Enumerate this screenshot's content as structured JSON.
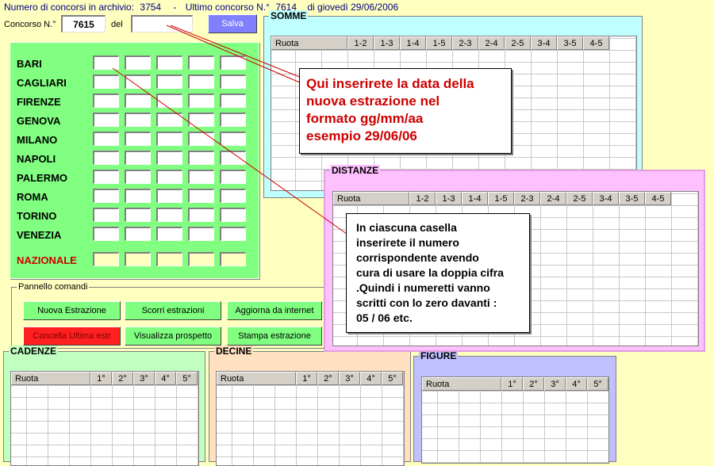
{
  "top": {
    "count_label": "Numero di concorsi in archivio:",
    "count_value": "3754",
    "sep": "-",
    "last_label": "Ultimo concorso N.°",
    "last_value": "7614",
    "date_label": "di giovedì 29/06/2006"
  },
  "form": {
    "concorso_label": "Concorso N.°",
    "concorso_value": "7615",
    "del_label": "del",
    "date_value": "",
    "save_label": "Salva"
  },
  "cities": [
    "BARI",
    "CAGLIARI",
    "FIRENZE",
    "GENOVA",
    "MILANO",
    "NAPOLI",
    "PALERMO",
    "ROMA",
    "TORINO",
    "VENEZIA"
  ],
  "nazionale": "NAZIONALE",
  "commands": {
    "title": "Pannello comandi",
    "nuova": "Nuova Estrazione",
    "scorri": "Scorri estrazioni",
    "aggiorna": "Aggiorna da internet",
    "cancella": "Cancella Ultima estr",
    "visualizza": "Visualizza prospetto",
    "stampa": "Stampa estrazione"
  },
  "somme": {
    "title": "SOMME",
    "headers": [
      "Ruota",
      "1-2",
      "1-3",
      "1-4",
      "1-5",
      "2-3",
      "2-4",
      "2-5",
      "3-4",
      "3-5",
      "4-5"
    ]
  },
  "distanze": {
    "title": "DISTANZE",
    "headers": [
      "Ruota",
      "1-2",
      "1-3",
      "1-4",
      "1-5",
      "2-3",
      "2-4",
      "2-5",
      "3-4",
      "3-5",
      "4-5"
    ]
  },
  "cadenze": {
    "title": "CADENZE",
    "headers": [
      "Ruota",
      "1°",
      "2°",
      "3°",
      "4°",
      "5°"
    ]
  },
  "decine": {
    "title": "DECINE",
    "headers": [
      "Ruota",
      "1°",
      "2°",
      "3°",
      "4°",
      "5°"
    ]
  },
  "figure": {
    "title": "FIGURE",
    "headers": [
      "Ruota",
      "1°",
      "2°",
      "3°",
      "4°",
      "5°"
    ]
  },
  "callout1": [
    "Qui inserirete la data della",
    "nuova estrazione nel",
    "formato gg/mm/aa",
    "esempio 29/06/06"
  ],
  "callout2": [
    "In ciascuna casella",
    "inserirete il numero",
    "corrispondente avendo",
    "cura di usare la doppia cifra",
    ".Quindi i numeretti vanno",
    "scritti con lo zero davanti :",
    "05 / 06 etc."
  ],
  "colors": {
    "bg": "#ffffc0",
    "green": "#80ff80",
    "somme": "#c0ffff",
    "distanze": "#ffc0ff",
    "decine": "#ffe0c0",
    "figure": "#c0c0ff",
    "cadenze": "#c0ffc0",
    "red_text": "#cc0000"
  }
}
